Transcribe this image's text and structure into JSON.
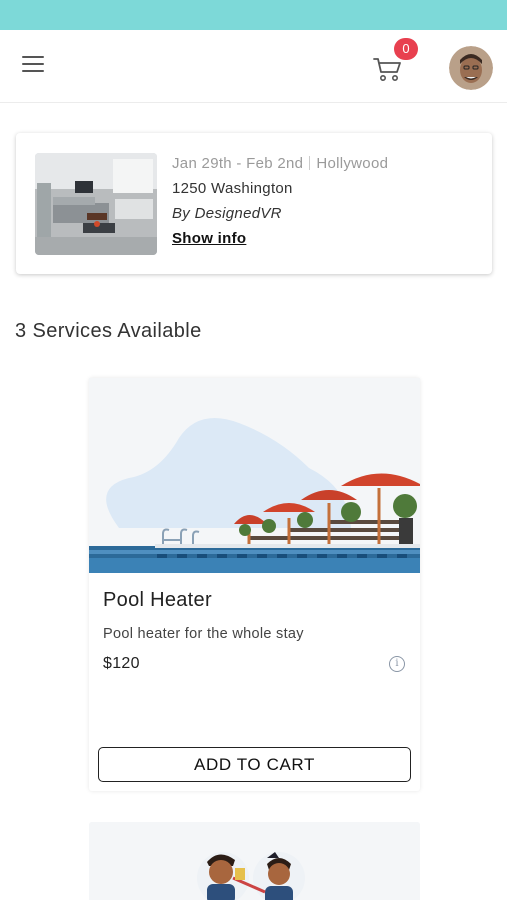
{
  "theme": {
    "status_strip_color": "#7dd9d8",
    "badge_color": "#e8404f"
  },
  "header": {
    "menu_icon": "hamburger-menu-icon",
    "cart_icon": "shopping-cart-icon",
    "cart_count": "0",
    "avatar_icon": "user-avatar"
  },
  "booking": {
    "dates": "Jan 29th - Feb 2nd",
    "location": "Hollywood",
    "address": "1250 Washington",
    "host": "By DesignedVR",
    "show_info_label": "Show info"
  },
  "services": {
    "heading": "3 Services Available",
    "items": [
      {
        "title": "Pool Heater",
        "description": "Pool heater for the whole stay",
        "price": "$120",
        "info_icon": "info-icon",
        "button_label": "ADD TO CART"
      }
    ]
  }
}
